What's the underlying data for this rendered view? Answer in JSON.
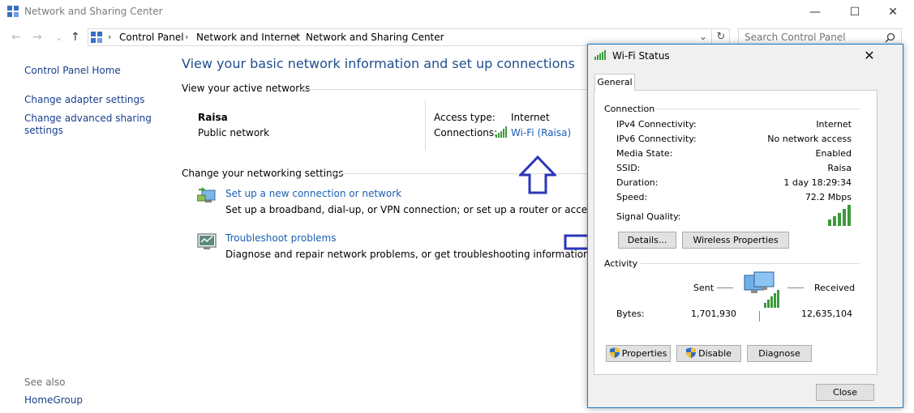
{
  "window": {
    "title": "Network and Sharing Center",
    "controls": {
      "minimize": "—",
      "maximize": "☐",
      "close": "✕"
    }
  },
  "addressbar": {
    "back": "←",
    "forward": "→",
    "up": "↑",
    "dropdown": "⌄",
    "refresh": "↻",
    "crumbs": [
      "Control Panel",
      "Network and Internet",
      "Network and Sharing Center"
    ],
    "separator": "›"
  },
  "search": {
    "placeholder": "Search Control Panel",
    "icon": "⌕"
  },
  "sidebar": {
    "home": "Control Panel Home",
    "links": [
      "Change adapter settings",
      "Change advanced sharing settings"
    ],
    "see_also_label": "See also",
    "see_also": [
      "HomeGroup"
    ]
  },
  "main": {
    "heading": "View your basic network information and set up connections",
    "active_networks_label": "View your active networks",
    "network_name": "Raisa",
    "network_type": "Public network",
    "access_type_label": "Access type:",
    "access_type_value": "Internet",
    "connections_label": "Connections:",
    "connections_value": "Wi-Fi (Raisa)",
    "change_settings_label": "Change your networking settings",
    "tasks": [
      {
        "title": "Set up a new connection or network",
        "desc": "Set up a broadband, dial-up, or VPN connection; or set up a router or access point."
      },
      {
        "title": "Troubleshoot problems",
        "desc": "Diagnose and repair network problems, or get troubleshooting information."
      }
    ]
  },
  "dialog": {
    "title": "Wi-Fi Status",
    "close": "✕",
    "tab": "General",
    "connection_label": "Connection",
    "fields": [
      {
        "label": "IPv4 Connectivity:",
        "value": "Internet"
      },
      {
        "label": "IPv6 Connectivity:",
        "value": "No network access"
      },
      {
        "label": "Media State:",
        "value": "Enabled"
      },
      {
        "label": "SSID:",
        "value": "Raisa"
      },
      {
        "label": "Duration:",
        "value": "1 day 18:29:34"
      },
      {
        "label": "Speed:",
        "value": "72.2 Mbps"
      }
    ],
    "signal_label": "Signal Quality:",
    "details_button": "Details...",
    "wireless_button": "Wireless Properties",
    "activity_label": "Activity",
    "sent_label": "Sent",
    "received_label": "Received",
    "bytes_label": "Bytes:",
    "bytes_sent": "1,701,930",
    "bytes_received": "12,635,104",
    "properties_button": "Properties",
    "disable_button": "Disable",
    "diagnose_button": "Diagnose",
    "close_button": "Close"
  },
  "colors": {
    "link": "#1a5fb4",
    "heading": "#1e4e8c",
    "arrow": "#2b36b8",
    "dialog_border": "#1979ca"
  }
}
